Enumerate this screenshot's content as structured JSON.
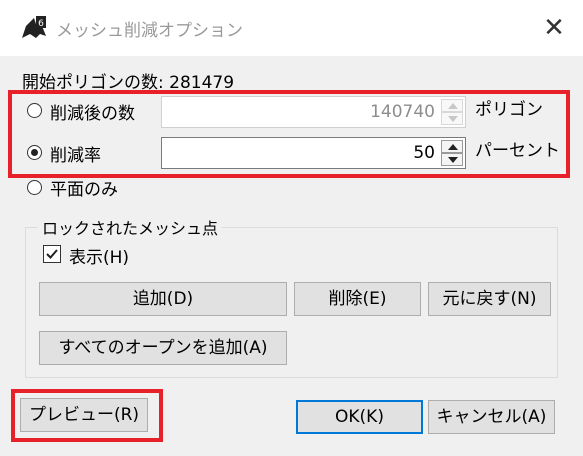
{
  "window": {
    "title": "メッシュ削減オプション",
    "close_glyph": "✕"
  },
  "info": {
    "label": "開始ポリゴンの数:",
    "value": "281479"
  },
  "options": {
    "count": {
      "label": "削減後の数",
      "value": "140740",
      "unit": "ポリゴン",
      "selected": false,
      "enabled": false
    },
    "ratio": {
      "label": "削減率",
      "value": "50",
      "unit": "パーセント",
      "selected": true,
      "enabled": true
    },
    "planar": {
      "label": "平面のみ"
    }
  },
  "locked": {
    "caption": "ロックされたメッシュ点",
    "show_label": "表示(H)",
    "show_checked": true,
    "add": "追加(D)",
    "remove": "削除(E)",
    "restore": "元に戻す(N)",
    "add_open": "すべてのオープンを追加(A)"
  },
  "footer": {
    "preview": "プレビュー(R)",
    "ok": "OK(K)",
    "cancel": "キャンセル(A)"
  },
  "colors": {
    "highlight": "#e8202a",
    "default_button_border": "#0078d7"
  },
  "icons": {
    "app": "rhino-icon",
    "close": "close-icon",
    "spin_up": "triangle-up-icon",
    "spin_down": "triangle-down-icon",
    "check": "check-icon"
  }
}
